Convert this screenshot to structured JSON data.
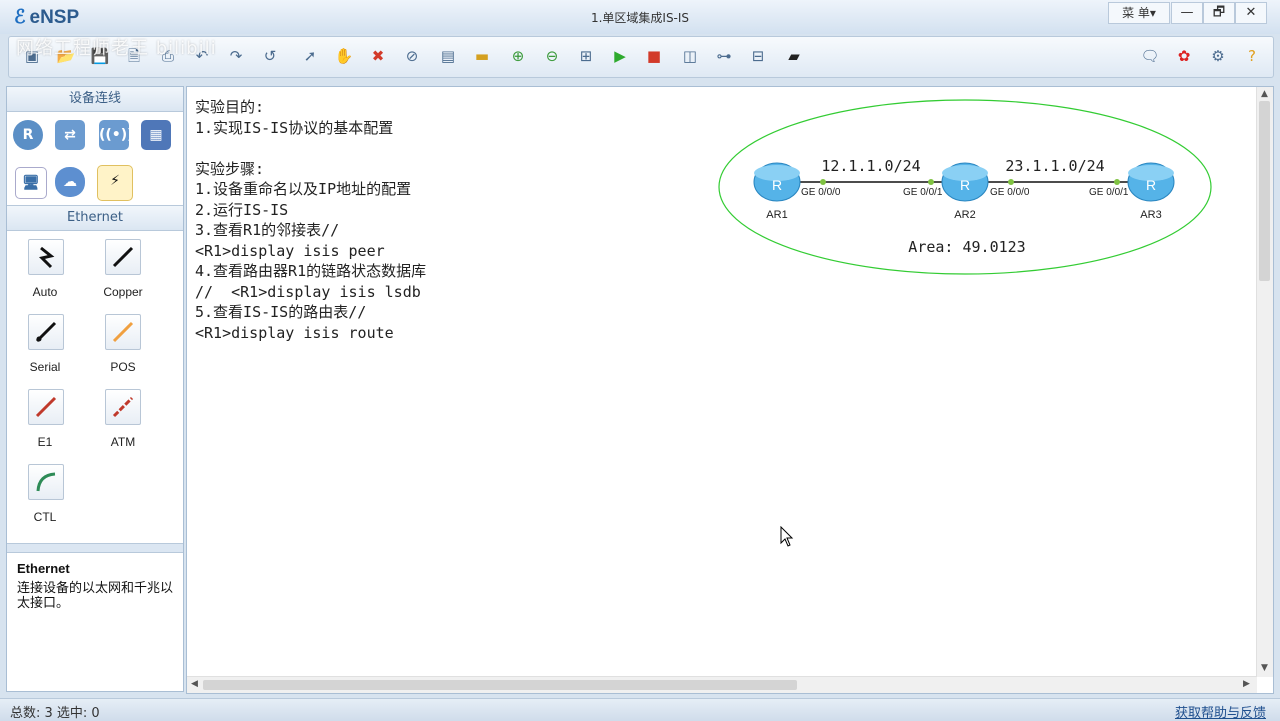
{
  "app": {
    "name": "eNSP",
    "window_title": "1.单区域集成IS-IS",
    "menu_label": "菜 单▾",
    "win_minimize": "—",
    "win_restore": "🗗",
    "win_close": "✕",
    "watermark": "网络工程师老王 bilibili"
  },
  "toolbar": {
    "left_tools": [
      "new-topology-icon",
      "open-icon",
      "save-icon",
      "save-as-icon",
      "print-icon",
      "undo-icon",
      "redo-icon",
      "select-icon",
      "pan-icon",
      "delete-icon",
      "delete-link-icon",
      "text-icon",
      "rectangle-icon",
      "zoom-in-icon",
      "zoom-out-icon",
      "fit-icon",
      "start-icon",
      "stop-icon",
      "capture-icon",
      "topology-icon",
      "grid-icon",
      "terminal-icon"
    ],
    "right_tools": [
      "chat-icon",
      "huawei-icon",
      "settings-icon",
      "help-icon"
    ]
  },
  "left_panel": {
    "devices_header": "设备连线",
    "device_icons": [
      "router-icon",
      "switch-icon",
      "wireless-icon",
      "firewall-icon",
      "pc-icon",
      "cloud-icon",
      "cable-icon"
    ],
    "cables_header": "Ethernet",
    "cables": [
      {
        "label": "Auto",
        "color": "#111111"
      },
      {
        "label": "Copper",
        "color": "#111111"
      },
      {
        "label": "Serial",
        "color": "#111111"
      },
      {
        "label": "POS",
        "color": "#f0a040"
      },
      {
        "label": "E1",
        "color": "#c0392b"
      },
      {
        "label": "ATM",
        "color": "#c0392b"
      },
      {
        "label": "CTL",
        "color": "#2e8b57"
      }
    ],
    "desc_title": "Ethernet",
    "desc_text": "连接设备的以太网和千兆以太接口。"
  },
  "canvas": {
    "notes_lines": [
      "实验目的:",
      "1.实现IS-IS协议的基本配置",
      "",
      "实验步骤:",
      "1.设备重命名以及IP地址的配置",
      "2.运行IS-IS",
      "3.查看R1的邻接表//",
      "<R1>display isis peer",
      "4.查看路由器R1的链路状态数据库",
      "//  <R1>display isis lsdb",
      "5.查看IS-IS的路由表//",
      "<R1>display isis route"
    ],
    "topology": {
      "routers": [
        "AR1",
        "AR2",
        "AR3"
      ],
      "router_glyph": "R",
      "link1_subnet": "12.1.1.0/24",
      "link2_subnet": "23.1.1.0/24",
      "ports": [
        "GE 0/0/0",
        "GE 0/0/1",
        "GE 0/0/0",
        "GE 0/0/1"
      ],
      "area": "Area: 49.0123",
      "area_color": "#33cc33",
      "link_dot_color": "#7fc241"
    }
  },
  "status": {
    "left": "总数: 3  选中: 0",
    "right": "获取帮助与反馈"
  }
}
